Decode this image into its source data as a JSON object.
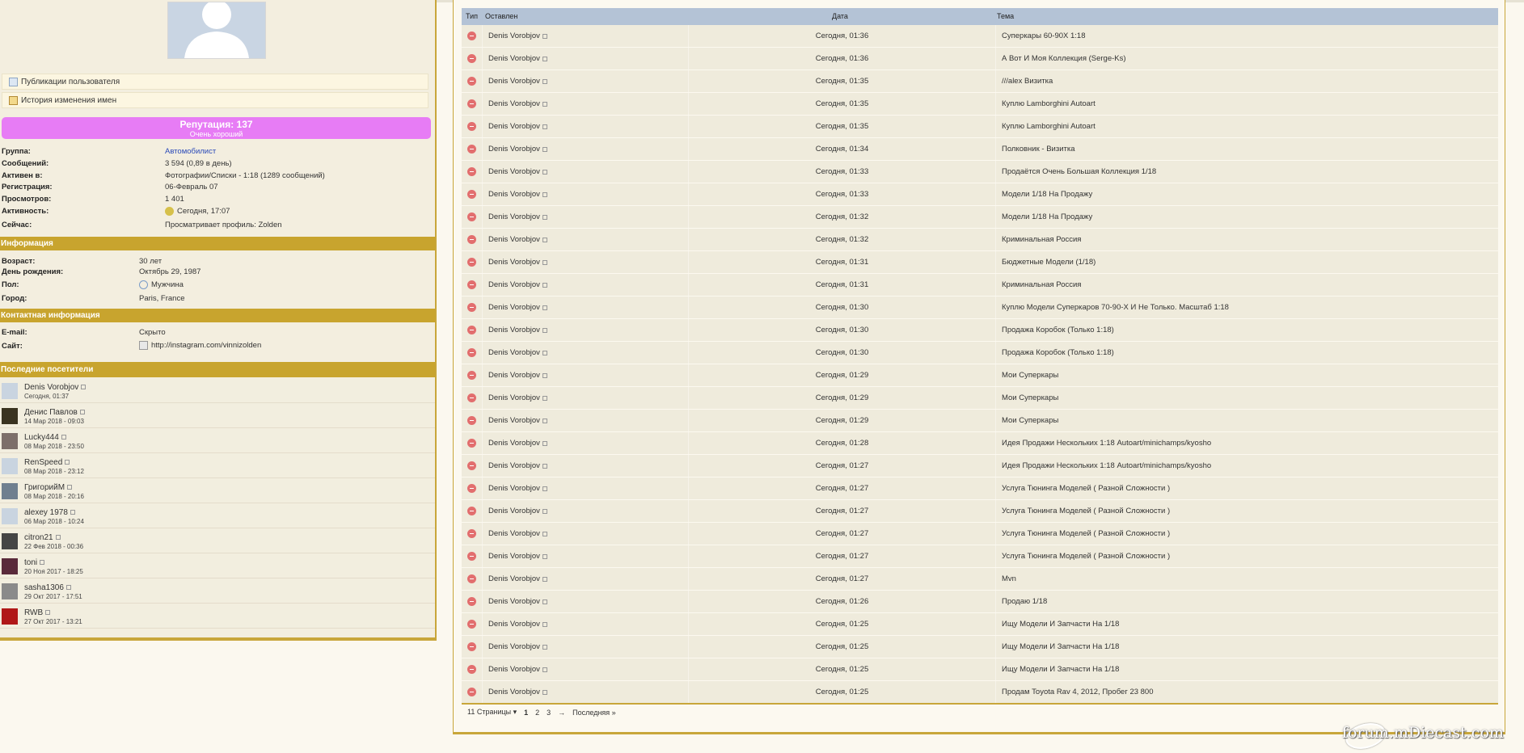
{
  "profile": {
    "links": [
      "Публикации пользователя",
      "История изменения имен"
    ],
    "reputation": {
      "title": "Репутация: 137",
      "subtitle": "Очень хороший"
    },
    "stats": [
      {
        "label": "Группа:",
        "value": "Автомобилист"
      },
      {
        "label": "Сообщений:",
        "value": "3 594 (0,89 в день)"
      },
      {
        "label": "Активен в:",
        "value": "Фотографии/Списки - 1:18 (1289 сообщений)"
      },
      {
        "label": "Регистрация:",
        "value": "06-Февраль 07"
      },
      {
        "label": "Просмотров:",
        "value": "1 401"
      },
      {
        "label": "Активность:",
        "value": "Сегодня, 17:07"
      },
      {
        "label": "Сейчас:",
        "value": "Просматривает профиль: Zolden"
      }
    ],
    "info_header": "Информация",
    "info": [
      {
        "label": "Возраст:",
        "value": "30 лет"
      },
      {
        "label": "День рождения:",
        "value": "Октябрь 29, 1987"
      },
      {
        "label": "Пол:",
        "value": "Мужчина"
      },
      {
        "label": "Город:",
        "value": "Paris, France"
      }
    ],
    "contact_header": "Контактная информация",
    "contact": [
      {
        "label": "E-mail:",
        "value": "Скрыто"
      },
      {
        "label": "Сайт:",
        "value": "http://instagram.com/vinnizolden"
      }
    ],
    "visitors_header": "Последние посетители",
    "visitors": [
      {
        "name": "Denis Vorobjov",
        "time": "Сегодня, 01:37",
        "thumb": "#c9d4e0"
      },
      {
        "name": "Денис Павлов",
        "time": "14 Мар 2018 - 09:03",
        "thumb": "#3a3320"
      },
      {
        "name": "Lucky444",
        "time": "08 Мар 2018 - 23:50",
        "thumb": "#7d6f6a"
      },
      {
        "name": "RenSpeed",
        "time": "08 Мар 2018 - 23:12",
        "thumb": "#c9d4e0"
      },
      {
        "name": "ГригорийМ",
        "time": "08 Мар 2018 - 20:16",
        "thumb": "#6f7f8f"
      },
      {
        "name": "alexey 1978",
        "time": "06 Мар 2018 - 10:24",
        "thumb": "#c9d4e0"
      },
      {
        "name": "citron21",
        "time": "22 Фев 2018 - 00:36",
        "thumb": "#454545"
      },
      {
        "name": "toni",
        "time": "20 Ноя 2017 - 18:25",
        "thumb": "#5a2a3a"
      },
      {
        "name": "sasha1306",
        "time": "29 Окт 2017 - 17:51",
        "thumb": "#8a8a8a"
      },
      {
        "name": "RWB",
        "time": "27 Окт 2017 - 13:21",
        "thumb": "#b01818"
      }
    ]
  },
  "table": {
    "headers": {
      "type": "Тип",
      "author": "Оставлен",
      "date": "Дата",
      "topic": "Тема"
    },
    "rows": [
      {
        "author": "Denis Vorobjov",
        "date": "Сегодня, 01:36",
        "topic": "Суперкары 60-90Х 1:18"
      },
      {
        "author": "Denis Vorobjov",
        "date": "Сегодня, 01:36",
        "topic": "А Вот И Моя Коллекция (Serge-Ks)"
      },
      {
        "author": "Denis Vorobjov",
        "date": "Сегодня, 01:35",
        "topic": "///alex Визитка"
      },
      {
        "author": "Denis Vorobjov",
        "date": "Сегодня, 01:35",
        "topic": "Куплю Lamborghini Autoart"
      },
      {
        "author": "Denis Vorobjov",
        "date": "Сегодня, 01:35",
        "topic": "Куплю Lamborghini Autoart"
      },
      {
        "author": "Denis Vorobjov",
        "date": "Сегодня, 01:34",
        "topic": "Полковник - Визитка"
      },
      {
        "author": "Denis Vorobjov",
        "date": "Сегодня, 01:33",
        "topic": "Продаётся Очень Большая Коллекция 1/18"
      },
      {
        "author": "Denis Vorobjov",
        "date": "Сегодня, 01:33",
        "topic": "Модели 1/18 На Продажу"
      },
      {
        "author": "Denis Vorobjov",
        "date": "Сегодня, 01:32",
        "topic": "Модели 1/18 На Продажу"
      },
      {
        "author": "Denis Vorobjov",
        "date": "Сегодня, 01:32",
        "topic": "Криминальная Россия"
      },
      {
        "author": "Denis Vorobjov",
        "date": "Сегодня, 01:31",
        "topic": "Бюджетные Модели (1/18)"
      },
      {
        "author": "Denis Vorobjov",
        "date": "Сегодня, 01:31",
        "topic": "Криминальная Россия"
      },
      {
        "author": "Denis Vorobjov",
        "date": "Сегодня, 01:30",
        "topic": "Куплю Модели Суперкаров 70-90-Х И Не Только. Масштаб 1:18"
      },
      {
        "author": "Denis Vorobjov",
        "date": "Сегодня, 01:30",
        "topic": "Продажа Коробок (Только 1:18)"
      },
      {
        "author": "Denis Vorobjov",
        "date": "Сегодня, 01:30",
        "topic": "Продажа Коробок (Только 1:18)"
      },
      {
        "author": "Denis Vorobjov",
        "date": "Сегодня, 01:29",
        "topic": "Мои Суперкары"
      },
      {
        "author": "Denis Vorobjov",
        "date": "Сегодня, 01:29",
        "topic": "Мои Суперкары"
      },
      {
        "author": "Denis Vorobjov",
        "date": "Сегодня, 01:29",
        "topic": "Мои Суперкары"
      },
      {
        "author": "Denis Vorobjov",
        "date": "Сегодня, 01:28",
        "topic": "Идея Продажи Нескольких 1:18 Autoart/minichamps/kyosho"
      },
      {
        "author": "Denis Vorobjov",
        "date": "Сегодня, 01:27",
        "topic": "Идея Продажи Нескольких 1:18 Autoart/minichamps/kyosho"
      },
      {
        "author": "Denis Vorobjov",
        "date": "Сегодня, 01:27",
        "topic": "Услуга Тюнинга Моделей ( Разной Сложности )"
      },
      {
        "author": "Denis Vorobjov",
        "date": "Сегодня, 01:27",
        "topic": "Услуга Тюнинга Моделей ( Разной Сложности )"
      },
      {
        "author": "Denis Vorobjov",
        "date": "Сегодня, 01:27",
        "topic": "Услуга Тюнинга Моделей ( Разной Сложности )"
      },
      {
        "author": "Denis Vorobjov",
        "date": "Сегодня, 01:27",
        "topic": "Услуга Тюнинга Моделей ( Разной Сложности )"
      },
      {
        "author": "Denis Vorobjov",
        "date": "Сегодня, 01:27",
        "topic": "Mvn"
      },
      {
        "author": "Denis Vorobjov",
        "date": "Сегодня, 01:26",
        "topic": "Продаю 1/18"
      },
      {
        "author": "Denis Vorobjov",
        "date": "Сегодня, 01:25",
        "topic": "Ищу Модели И Запчасти На 1/18"
      },
      {
        "author": "Denis Vorobjov",
        "date": "Сегодня, 01:25",
        "topic": "Ищу Модели И Запчасти На 1/18"
      },
      {
        "author": "Denis Vorobjov",
        "date": "Сегодня, 01:25",
        "topic": "Ищу Модели И Запчасти На 1/18"
      },
      {
        "author": "Denis Vorobjov",
        "date": "Сегодня, 01:25",
        "topic": "Продам Toyota Rav 4, 2012, Пробег 23 800"
      }
    ]
  },
  "pager": {
    "pages_label": "11 Страницы ▾",
    "p1": "1",
    "p2": "2",
    "p3": "3",
    "sep": "→",
    "last": "Последняя »"
  },
  "logo": "forum.mDiecast.com"
}
